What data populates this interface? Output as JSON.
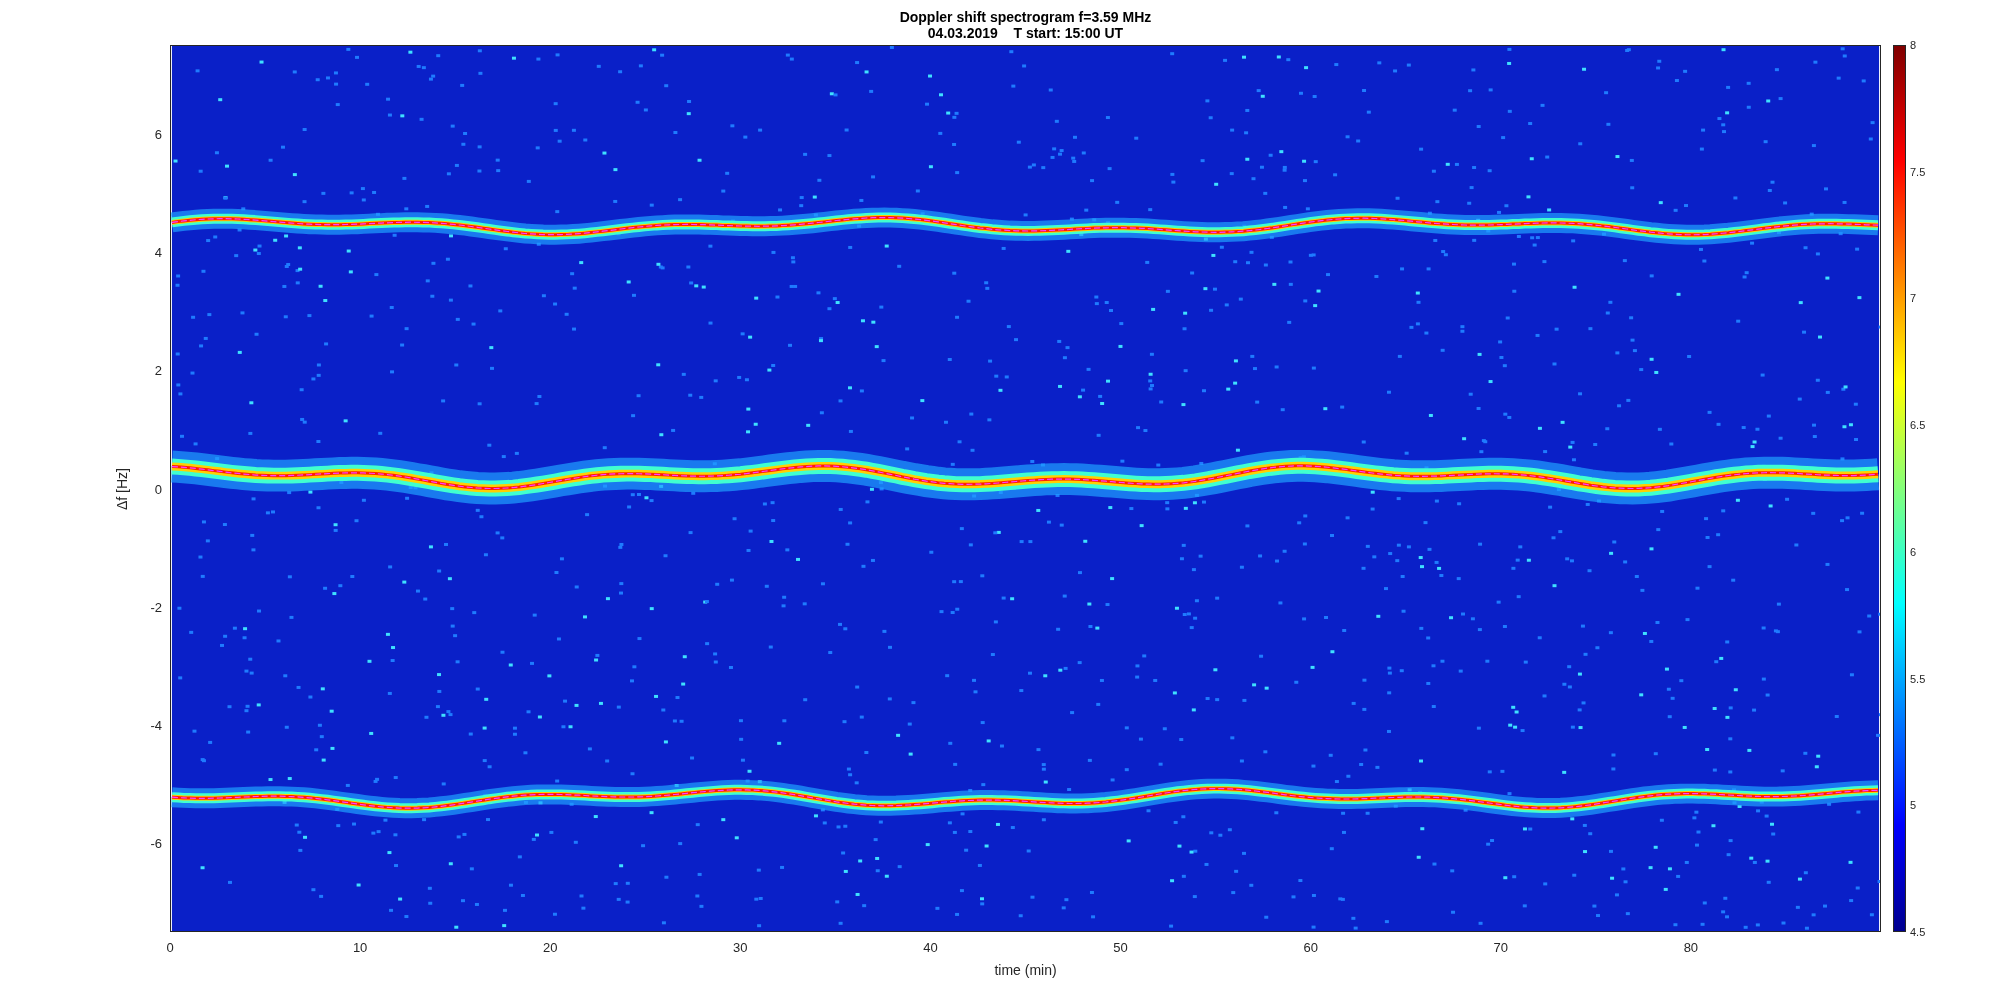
{
  "title": "Doppler shift spectrogram f=3.59 MHz",
  "subtitle": "04.03.2019    T start: 15:00 UT",
  "ylabel": "Δf [Hz]",
  "xlabel": "time (min)",
  "xticks": [
    "0",
    "10",
    "20",
    "30",
    "40",
    "50",
    "60",
    "70",
    "80"
  ],
  "yticks": [
    "6",
    "4",
    "2",
    "0",
    "-2",
    "-4",
    "-6"
  ],
  "colorbar_ticks": [
    "8",
    "7.5",
    "7",
    "6.5",
    "6",
    "5.5",
    "5",
    "4.5"
  ]
}
